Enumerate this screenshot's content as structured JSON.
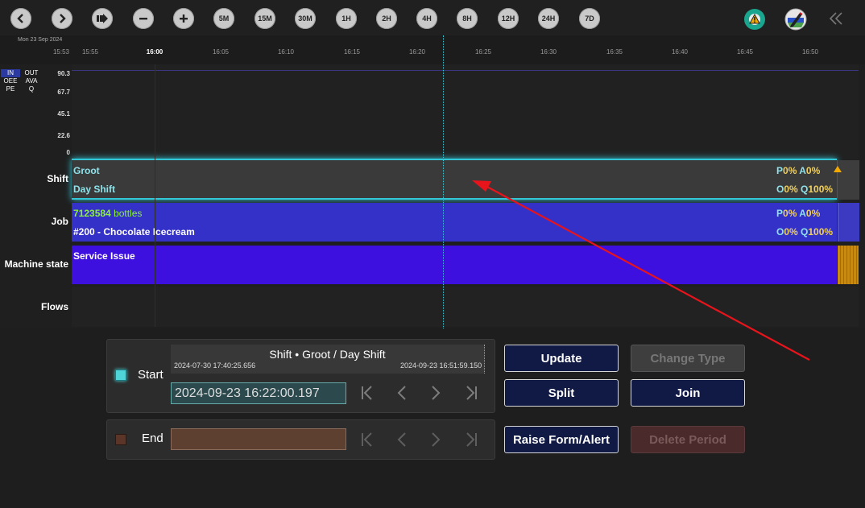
{
  "toolbar": {
    "zoom_buttons": [
      "5M",
      "15M",
      "30M",
      "1H",
      "2H",
      "4H",
      "8H",
      "12H",
      "24H",
      "7D"
    ]
  },
  "timeline": {
    "date": "Mon 23 Sep 2024",
    "ticks": [
      "15:53",
      "15:55",
      "16:00",
      "16:05",
      "16:10",
      "16:15",
      "16:20",
      "16:25",
      "16:30",
      "16:35",
      "16:40",
      "16:45",
      "16:50"
    ],
    "in_label": "IN",
    "out_label": "OUT",
    "oee_label": "OEE",
    "ava_label": "AVA",
    "pe_label": "PE",
    "q_label": "Q",
    "y_ticks": [
      "90.3",
      "67.7",
      "45.1",
      "22.6",
      "0"
    ]
  },
  "rows": {
    "shift_label": "Shift",
    "job_label": "Job",
    "machine_label": "Machine state",
    "flows_label": "Flows"
  },
  "shift": {
    "name": "Groot",
    "shift_name": "Day Shift",
    "p_letter": "P",
    "p_val": "0%",
    "a_letter": "A",
    "a_val": "0%",
    "o_letter": "O",
    "o_val": "0%",
    "q_letter": "Q",
    "q_val": "100%"
  },
  "job": {
    "count": "7123584",
    "unit": "bottles",
    "name": "#200 - Chocolate Icecream",
    "p_letter": "P",
    "p_val": "0%",
    "a_letter": "A",
    "a_val": "0%",
    "o_letter": "O",
    "o_val": "0%",
    "q_letter": "Q",
    "q_val": "100%"
  },
  "machine_state": {
    "label": "Service Issue"
  },
  "editor": {
    "start_label": "Start",
    "end_label": "End",
    "period_title": "Shift • Groot / Day Shift",
    "period_start": "2024-07-30 17:40:25.656",
    "period_end": "2024-09-23 16:51:59.150",
    "start_value": "2024-09-23 16:22:00.197",
    "end_value": ""
  },
  "actions": {
    "update": "Update",
    "change_type": "Change Type",
    "split": "Split",
    "join": "Join",
    "raise": "Raise Form/Alert",
    "delete": "Delete Period"
  },
  "colors": {
    "shift_band": "#3a3a3a",
    "job_band": "#3431c8",
    "machine_band": "#3e10e0",
    "accent_cyan": "#32c7d6",
    "annotation_arrow": "#e8141c",
    "button_bg": "#111a45"
  }
}
